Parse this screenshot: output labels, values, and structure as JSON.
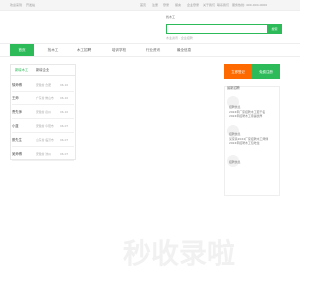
{
  "top": {
    "left_items": [
      "欢迎来到",
      "开发站"
    ],
    "right_items": [
      "首页",
      "注册",
      "登录",
      "留言",
      "企业登录",
      "关于我们",
      "联系我们",
      "服务热线: 400-000-0000"
    ]
  },
  "search": {
    "label": "找木工",
    "placeholder": "",
    "button_label": "搜索",
    "hint": "木业资讯 · 企业招聘"
  },
  "nav": {
    "items": [
      "首页",
      "找木工",
      "木工招聘",
      "培训学校",
      "行业资讯",
      "最全信息"
    ]
  },
  "left_list": {
    "tabs": [
      "新增木工",
      "新增企业"
    ],
    "rows": [
      {
        "name": "徐师傅",
        "loc": "安徽省 合肥",
        "date": "06-10"
      },
      {
        "name": "王师",
        "loc": "广东省 佛山市",
        "date": "06-10"
      },
      {
        "name": "曹先师",
        "loc": "安徽省 宿州",
        "date": "06-10"
      },
      {
        "name": "小蓝",
        "loc": "安徽省 阜阳市",
        "date": "06-07"
      },
      {
        "name": "蔡先生",
        "loc": "山东省 临沂市",
        "date": "06-07"
      },
      {
        "name": "吴师傅",
        "loc": "安徽省 池州",
        "date": "06-07"
      }
    ]
  },
  "side": {
    "btn_orange": "立即登记",
    "btn_green": "免费注册",
    "title": "最新招聘",
    "items": [
      {
        "t1": "招聘信息",
        "t2": "2024年厂家招聘木工若干名",
        "t3": "2024年招聘木工待遇优厚"
      },
      {
        "t1": "招聘信息",
        "t2": "某家具2024厂家招聘木工师傅",
        "t3": "2024年招聘木工包吃住"
      },
      {
        "t1": "招聘信息",
        "t2": "",
        "t3": ""
      }
    ]
  },
  "watermark": "秒收录啦"
}
